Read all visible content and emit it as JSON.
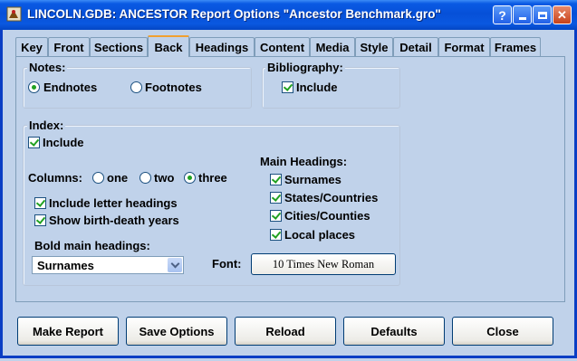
{
  "window": {
    "title": "LINCOLN.GDB: ANCESTOR  Report Options \"Ancestor Benchmark.gro\"",
    "help_label": "?",
    "minimize_label": "_",
    "maximize_label": "□",
    "close_label": "✕"
  },
  "tabs": [
    "Key",
    "Front",
    "Sections",
    "Back",
    "Headings",
    "Content",
    "Media",
    "Style",
    "Detail",
    "Format",
    "Frames"
  ],
  "active_tab": "Back",
  "notes": {
    "legend": "Notes:",
    "endnotes_label": "Endnotes",
    "footnotes_label": "Footnotes",
    "selected": "Endnotes"
  },
  "bibliography": {
    "legend": "Bibliography:",
    "include_label": "Include",
    "include_checked": true
  },
  "index": {
    "legend": "Index:",
    "include_label": "Include",
    "include_checked": true,
    "columns_label": "Columns:",
    "columns_options": [
      "one",
      "two",
      "three"
    ],
    "columns_selected": "three",
    "letter_headings_label": "Include letter headings",
    "letter_headings_checked": true,
    "birth_death_label": "Show birth-death years",
    "birth_death_checked": true,
    "bold_main_label": "Bold main headings:",
    "bold_main_value": "Surnames",
    "main_headings_label": "Main Headings:",
    "main_headings": [
      {
        "label": "Surnames",
        "checked": true
      },
      {
        "label": "States/Countries",
        "checked": true
      },
      {
        "label": "Cities/Counties",
        "checked": true
      },
      {
        "label": "Local places",
        "checked": true
      }
    ],
    "font_label": "Font:",
    "font_button": "10 Times New Roman"
  },
  "buttons": {
    "make_report": "Make Report",
    "save_options": "Save Options",
    "reload": "Reload",
    "defaults": "Defaults",
    "close": "Close"
  },
  "colors": {
    "dialog_bg": "#c0d2ea",
    "titlebar": "#0650d8",
    "check_green": "#21a121"
  }
}
